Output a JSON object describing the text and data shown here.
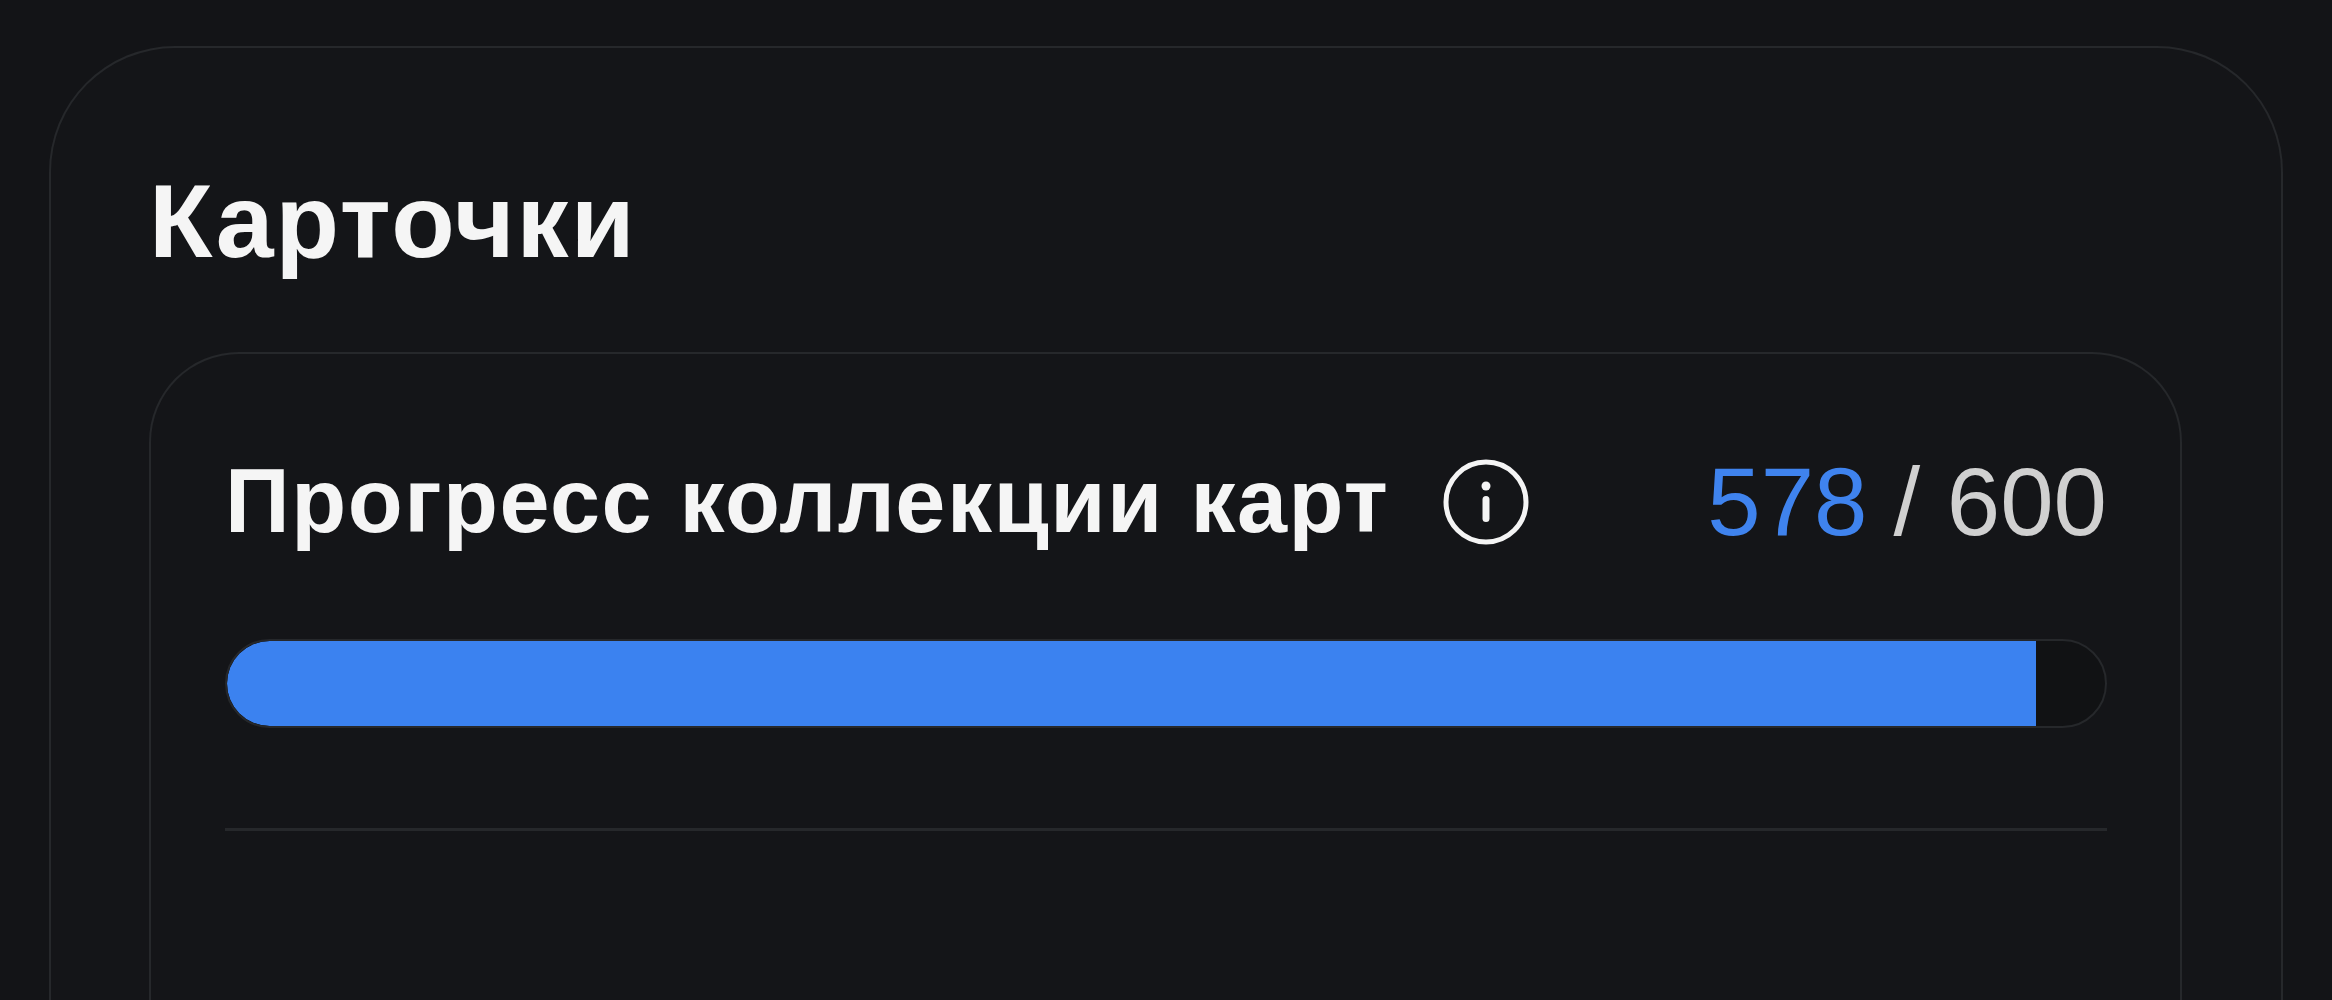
{
  "section": {
    "title": "Карточки"
  },
  "progress_card": {
    "label": "Прогресс коллекции карт",
    "count": "578",
    "total": "/ 600",
    "level": 0.963
  }
}
